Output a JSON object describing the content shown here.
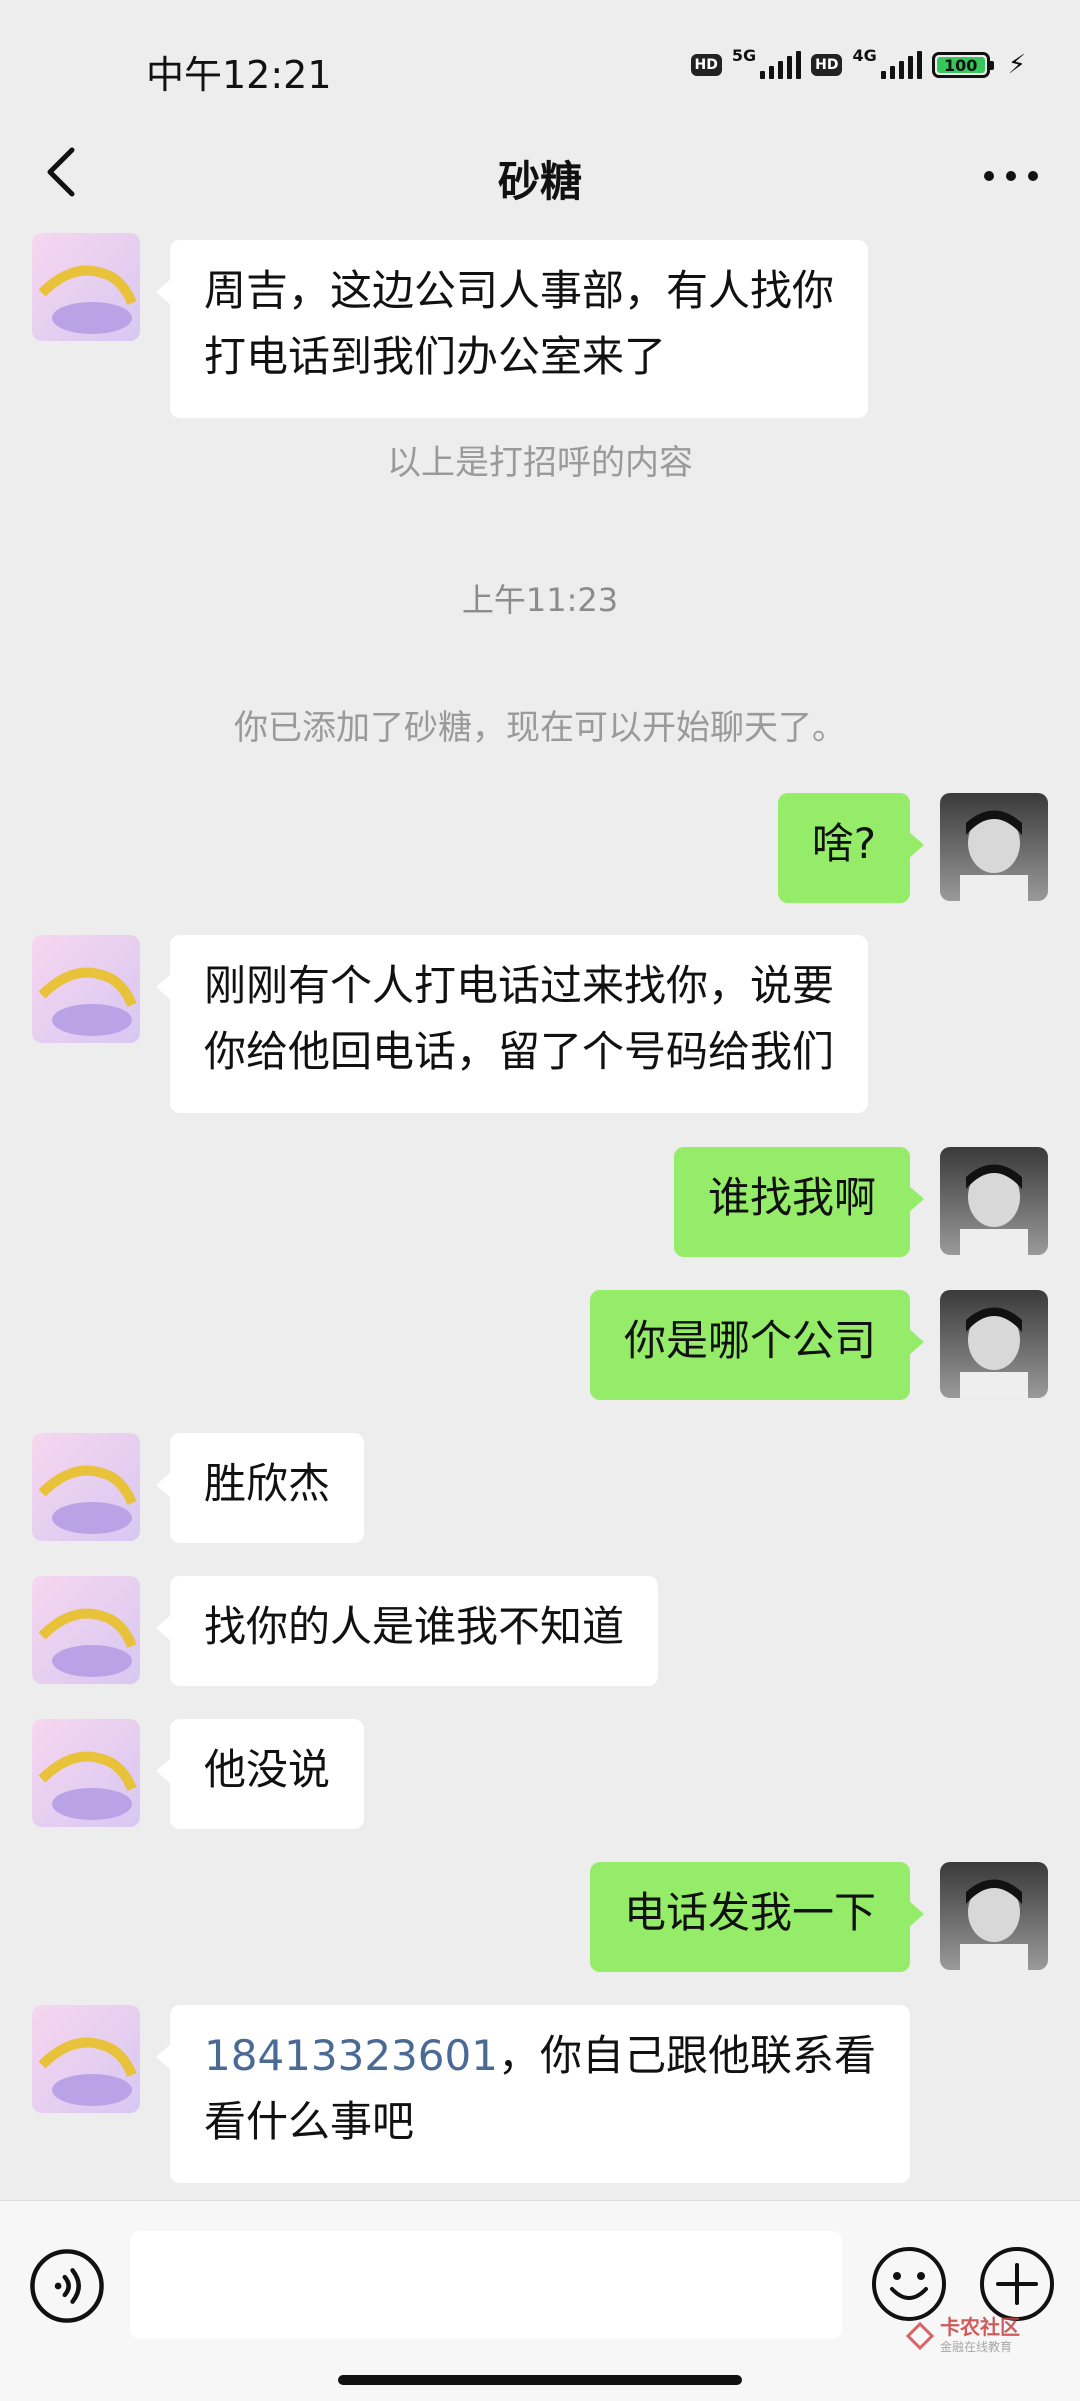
{
  "status": {
    "time": "中午12:21",
    "hd1": "HD",
    "net1": "5G",
    "hd2": "HD",
    "net2": "4G",
    "battery": "100"
  },
  "nav": {
    "title": "砂糖"
  },
  "messages": {
    "m0": "周吉，这边公司人事部，有人找你",
    "m0b": "打电话到我们办公室来了",
    "sys_greeting": "以上是打招呼的内容",
    "time1": "上午11:23",
    "sys_added": "你已添加了砂糖，现在可以开始聊天了。",
    "m1": "啥?",
    "m2a": "刚刚有个人打电话过来找你，说要",
    "m2b": "你给他回电话，留了个号码给我们",
    "m3": "谁找我啊",
    "m4": "你是哪个公司",
    "m5": "胜欣杰",
    "m6": "找你的人是谁我不知道",
    "m7": "他没说",
    "m8": "电话发我一下",
    "m9_phone": "18413323601",
    "m9a_rest": "，你自己跟他联系看",
    "m9b": "看什么事吧"
  },
  "input": {
    "placeholder": ""
  },
  "watermark": {
    "name": "卡农社区",
    "sub": "金融在线教育"
  },
  "colors": {
    "background": "#ededed",
    "outgoing_bubble": "#95ec69",
    "incoming_bubble": "#ffffff",
    "link": "#4a6a95"
  }
}
